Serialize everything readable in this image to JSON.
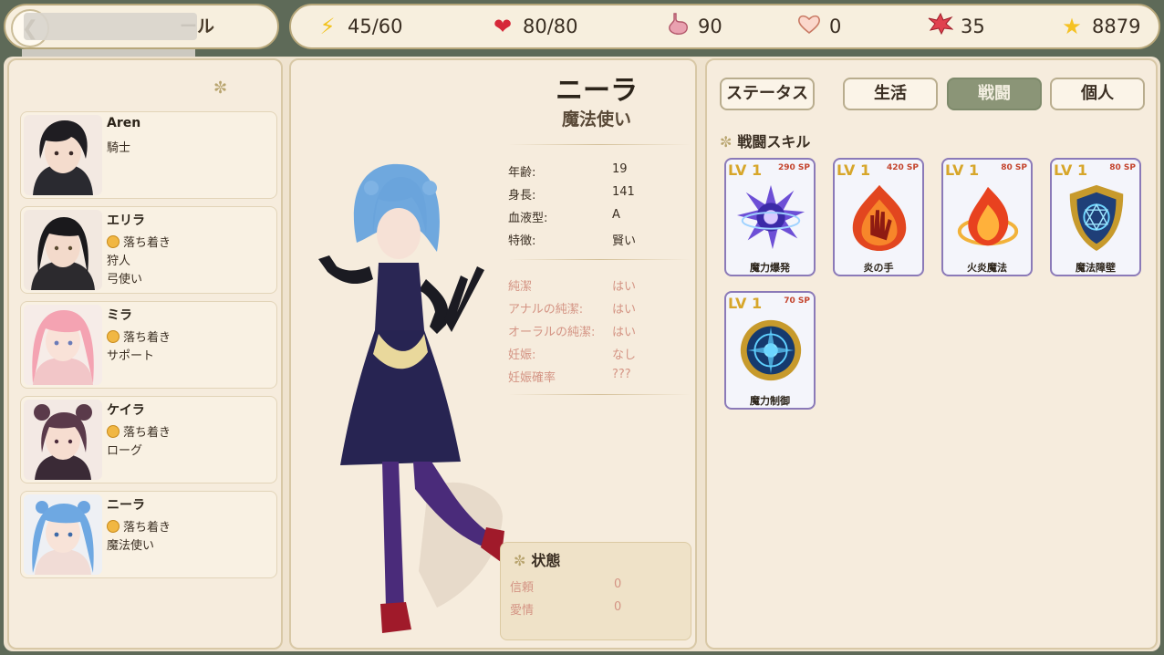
{
  "header": {
    "back_icon": "back-arrow-icon",
    "title_visible_fragment": "ール"
  },
  "stats": [
    {
      "icon": "lightning-icon",
      "value": "45/60",
      "color": "#f2c21b"
    },
    {
      "icon": "heart-icon",
      "value": "80/80",
      "color": "#d62839"
    },
    {
      "icon": "stomach-icon",
      "value": "90",
      "color": "#d98da0"
    },
    {
      "icon": "affection-heart-icon",
      "value": "0",
      "color": "#f4b7a8"
    },
    {
      "icon": "burst-icon",
      "value": "35",
      "color": "#e0414e"
    },
    {
      "icon": "star-icon",
      "value": "8879",
      "color": "#f5c223"
    }
  ],
  "characters": [
    {
      "name": "Aren",
      "lines": [
        "騎士"
      ]
    },
    {
      "name": "エリラ",
      "mood": "落ち着き",
      "lines": [
        "狩人",
        "弓使い"
      ]
    },
    {
      "name": "ミラ",
      "mood": "落ち着き",
      "lines": [
        "サポート"
      ]
    },
    {
      "name": "ケイラ",
      "mood": "落ち着き",
      "lines": [
        "ローグ"
      ]
    },
    {
      "name": "ニーラ",
      "mood": "落ち着き",
      "lines": [
        "魔法使い"
      ]
    }
  ],
  "profile": {
    "name": "ニーラ",
    "class": "魔法使い",
    "basic": [
      {
        "label": "年齢:",
        "value": "19"
      },
      {
        "label": "身長:",
        "value": "141"
      },
      {
        "label": "血液型:",
        "value": "A"
      },
      {
        "label": "特徴:",
        "value": "賢い"
      }
    ],
    "extra": [
      {
        "label": "純潔",
        "value": "はい"
      },
      {
        "label": "アナルの純潔:",
        "value": "はい"
      },
      {
        "label": "オーラルの純潔:",
        "value": "はい"
      },
      {
        "label": "妊娠:",
        "value": "なし"
      },
      {
        "label": "妊娠確率",
        "value": "???"
      }
    ]
  },
  "status": {
    "title": "状態",
    "rows": [
      {
        "label": "信頼",
        "value": "0"
      },
      {
        "label": "愛情",
        "value": "0"
      }
    ]
  },
  "tabs": [
    {
      "label": "ステータス",
      "active": false
    },
    {
      "label": "生活",
      "active": false
    },
    {
      "label": "戦闘",
      "active": true
    },
    {
      "label": "個人",
      "active": false
    }
  ],
  "skills_title": "戦闘スキル",
  "skills": [
    {
      "level": "LV 1",
      "sp": "290 SP",
      "name": "魔力爆発",
      "icon": "magic-burst-icon"
    },
    {
      "level": "LV 1",
      "sp": "420 SP",
      "name": "炎の手",
      "icon": "flame-hand-icon"
    },
    {
      "level": "LV 1",
      "sp": "80 SP",
      "name": "火炎魔法",
      "icon": "fire-magic-icon"
    },
    {
      "level": "LV 1",
      "sp": "80 SP",
      "name": "魔法障壁",
      "icon": "magic-shield-icon"
    },
    {
      "level": "LV 1",
      "sp": "70 SP",
      "name": "魔力制御",
      "icon": "magic-control-icon"
    }
  ]
}
